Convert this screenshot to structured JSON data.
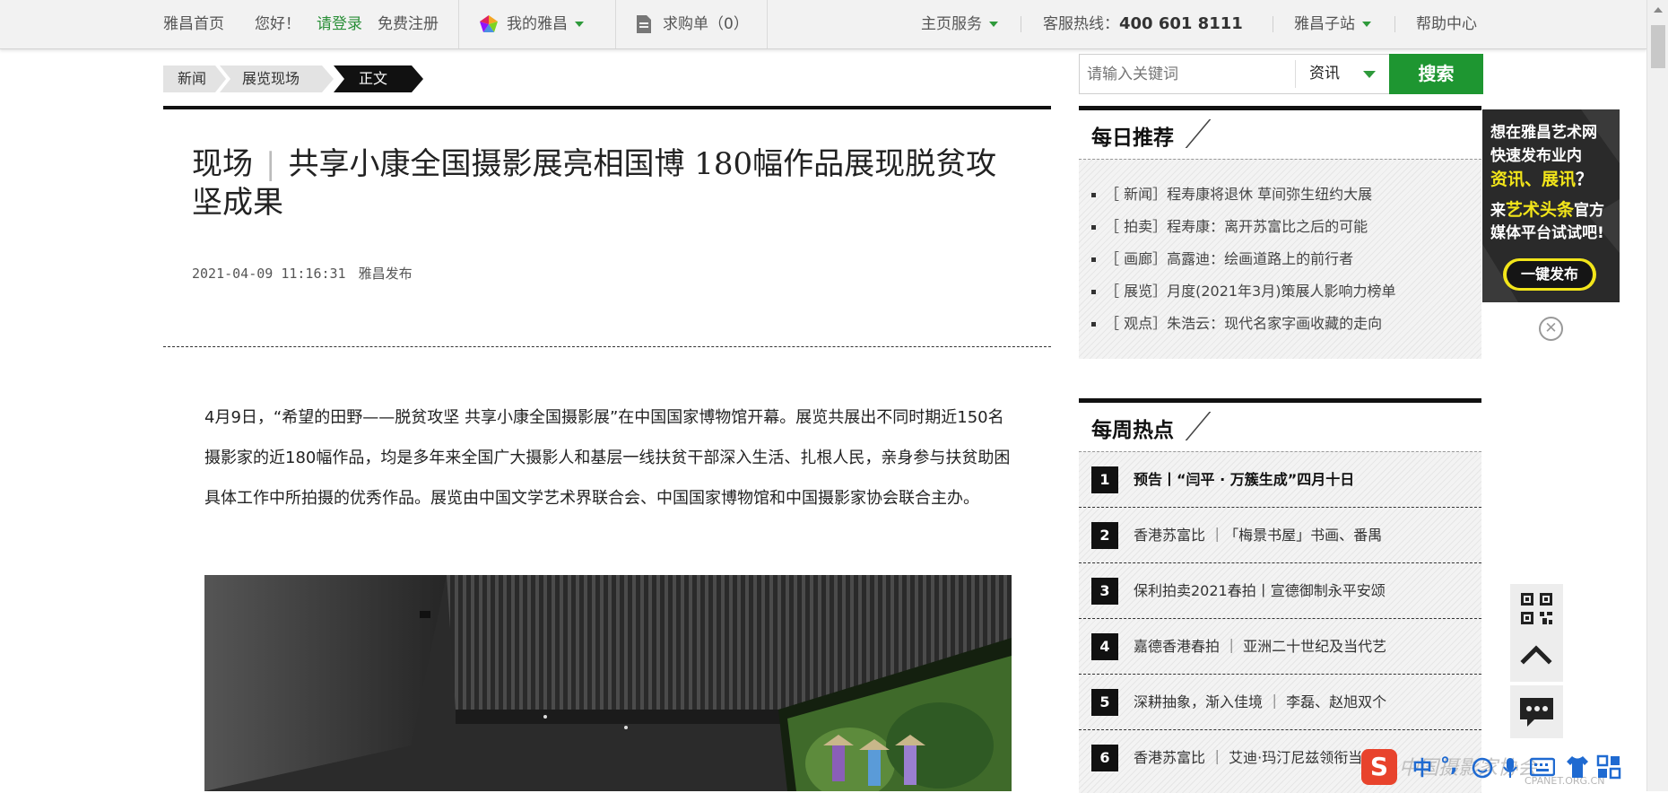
{
  "topnav": {
    "home": "雅昌首页",
    "greeting": "您好！",
    "login": "请登录",
    "register": "免费注册",
    "my_artron": "我的雅昌",
    "cart": "求购单（0）",
    "home_service": "主页服务",
    "hotline_label": "客服热线：",
    "hotline_number": "400 601 8111",
    "substations": "雅昌子站",
    "help": "帮助中心"
  },
  "breadcrumb": [
    "新闻",
    "展览现场",
    "正文"
  ],
  "article": {
    "title_tag": "现场",
    "title": "共享小康全国摄影展亮相国博 180幅作品展现脱贫攻坚成果",
    "datetime": "2021-04-09 11:16:31",
    "publisher": "雅昌发布",
    "paragraph": "4月9日，“希望的田野——脱贫攻坚 共享小康全国摄影展”在中国国家博物馆开幕。展览共展出不同时期近150名摄影家的近180幅作品，均是多年来全国广大摄影人和基层一线扶贫干部深入生活、扎根人民，亲身参与扶贫助困具体工作中所拍摄的优秀作品。展览由中国文学艺术界联合会、中国国家博物馆和中国摄影家协会联合主办。"
  },
  "search": {
    "placeholder": "请输入关键词",
    "category": "资讯",
    "button": "搜索"
  },
  "daily": {
    "heading": "每日推荐",
    "items": [
      {
        "tag": "［ 新闻］",
        "text": "程寿康将退休 草间弥生纽约大展"
      },
      {
        "tag": "［ 拍卖］",
        "text": "程寿康：离开苏富比之后的可能"
      },
      {
        "tag": "［ 画廊］",
        "text": "高露迪：绘画道路上的前行者"
      },
      {
        "tag": "［ 展览］",
        "text": "月度(2021年3月)策展人影响力榜单"
      },
      {
        "tag": "［ 观点］",
        "text": "朱浩云：现代名家字画收藏的走向"
      }
    ]
  },
  "weekly": {
    "heading": "每周热点",
    "items": [
      {
        "num": "1",
        "text": "预告丨“闫平 · 万簇生成”四月十日"
      },
      {
        "num": "2",
        "text": "香港苏富比 ｜「梅景书屋」书画、番禺"
      },
      {
        "num": "3",
        "text": "保利拍卖2021春拍丨宣德御制永平安颂"
      },
      {
        "num": "4",
        "text": "嘉德香港春拍 ｜ 亚洲二十世纪及当代艺"
      },
      {
        "num": "5",
        "text": "深耕抽象，渐入佳境 ｜ 李磊、赵旭双个"
      },
      {
        "num": "6",
        "text": "香港苏富比 ｜ 艾迪·玛汀尼兹领衔当"
      }
    ]
  },
  "ad": {
    "line1": "想在雅昌艺术网",
    "line2": "快速发布业内",
    "line3a": "资讯、展讯",
    "line3b": "？",
    "line4a": "来",
    "line4b": "艺术头条",
    "line4c": "官方",
    "line5": "媒体平台试试吧!",
    "button": "一键发布",
    "close": "✕"
  },
  "ime": {
    "logo": "S",
    "lang": "中",
    "punct": "°,"
  },
  "watermark": {
    "main": "中国摄影家协会",
    "url": "CPANET.ORG.CN"
  },
  "colors": {
    "brand_green": "#1e9631",
    "dark": "#111111"
  }
}
